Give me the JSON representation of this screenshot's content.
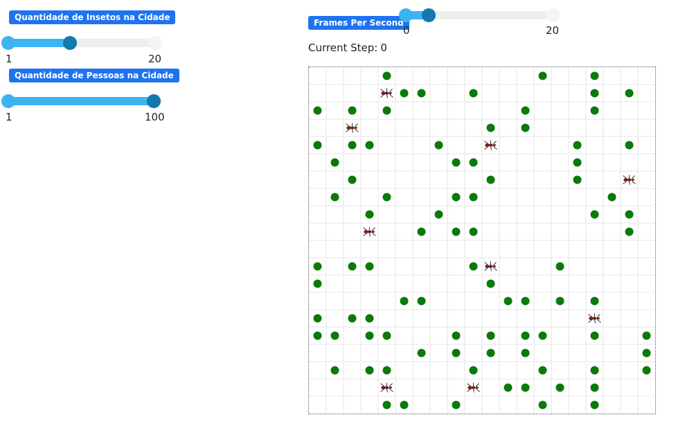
{
  "controls": {
    "insects": {
      "label": "Quantidade de Insetos na Cidade",
      "min": "1",
      "max": "20",
      "value": 10
    },
    "people": {
      "label": "Quantidade de Pessoas na Cidade",
      "min": "1",
      "max": "100",
      "value": 100
    },
    "fps": {
      "label": "Frames Per Second",
      "min": "0",
      "max": "20",
      "value": 2
    }
  },
  "status": {
    "step_label": "Current Step:",
    "step_value": "0"
  },
  "grid": {
    "cols": 20,
    "rows": 20,
    "person_color": "#0a7a0a",
    "insect_icon": "ant-icon",
    "people": [
      [
        4,
        0
      ],
      [
        13,
        0
      ],
      [
        16,
        0
      ],
      [
        5,
        1
      ],
      [
        6,
        1
      ],
      [
        9,
        1
      ],
      [
        16,
        1
      ],
      [
        18,
        1
      ],
      [
        0,
        2
      ],
      [
        2,
        2
      ],
      [
        4,
        2
      ],
      [
        12,
        2
      ],
      [
        16,
        2
      ],
      [
        10,
        3
      ],
      [
        12,
        3
      ],
      [
        0,
        4
      ],
      [
        2,
        4
      ],
      [
        3,
        4
      ],
      [
        7,
        4
      ],
      [
        15,
        4
      ],
      [
        18,
        4
      ],
      [
        1,
        5
      ],
      [
        8,
        5
      ],
      [
        9,
        5
      ],
      [
        15,
        5
      ],
      [
        2,
        6
      ],
      [
        10,
        6
      ],
      [
        15,
        6
      ],
      [
        1,
        7
      ],
      [
        4,
        7
      ],
      [
        8,
        7
      ],
      [
        9,
        7
      ],
      [
        17,
        7
      ],
      [
        3,
        8
      ],
      [
        7,
        8
      ],
      [
        16,
        8
      ],
      [
        18,
        8
      ],
      [
        6,
        9
      ],
      [
        8,
        9
      ],
      [
        9,
        9
      ],
      [
        18,
        9
      ],
      [
        0,
        11
      ],
      [
        2,
        11
      ],
      [
        3,
        11
      ],
      [
        9,
        11
      ],
      [
        14,
        11
      ],
      [
        0,
        12
      ],
      [
        10,
        12
      ],
      [
        5,
        13
      ],
      [
        6,
        13
      ],
      [
        11,
        13
      ],
      [
        12,
        13
      ],
      [
        14,
        13
      ],
      [
        16,
        13
      ],
      [
        0,
        14
      ],
      [
        2,
        14
      ],
      [
        3,
        14
      ],
      [
        0,
        15
      ],
      [
        1,
        15
      ],
      [
        3,
        15
      ],
      [
        4,
        15
      ],
      [
        8,
        15
      ],
      [
        10,
        15
      ],
      [
        12,
        15
      ],
      [
        13,
        15
      ],
      [
        16,
        15
      ],
      [
        19,
        15
      ],
      [
        6,
        16
      ],
      [
        8,
        16
      ],
      [
        10,
        16
      ],
      [
        12,
        16
      ],
      [
        19,
        16
      ],
      [
        1,
        17
      ],
      [
        3,
        17
      ],
      [
        4,
        17
      ],
      [
        9,
        17
      ],
      [
        13,
        17
      ],
      [
        16,
        17
      ],
      [
        19,
        17
      ],
      [
        11,
        18
      ],
      [
        12,
        18
      ],
      [
        14,
        18
      ],
      [
        16,
        18
      ],
      [
        4,
        19
      ],
      [
        5,
        19
      ],
      [
        8,
        19
      ],
      [
        13,
        19
      ],
      [
        16,
        19
      ]
    ],
    "insects": [
      [
        4,
        1
      ],
      [
        2,
        3
      ],
      [
        10,
        4
      ],
      [
        18,
        6
      ],
      [
        3,
        9
      ],
      [
        10,
        11
      ],
      [
        16,
        14
      ],
      [
        4,
        18
      ],
      [
        9,
        18
      ]
    ]
  }
}
